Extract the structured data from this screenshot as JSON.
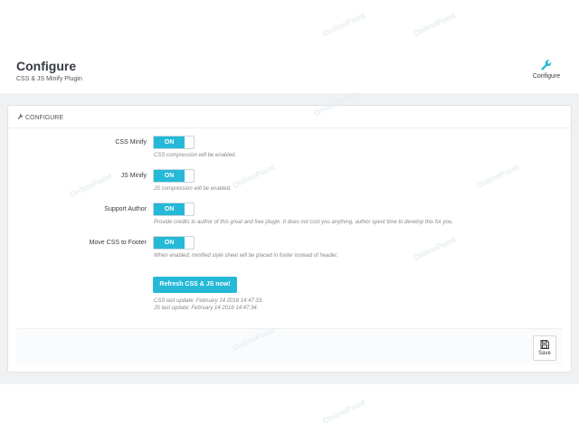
{
  "header": {
    "title": "Configure",
    "subtitle": "CSS & JS Minify Plugin",
    "toolbar_button_label": "Configure"
  },
  "panel": {
    "heading": "CONFIGURE",
    "fields": [
      {
        "label": "CSS Minify",
        "switch_label": "ON",
        "help": "CSS compression will be enabled."
      },
      {
        "label": "JS Minify",
        "switch_label": "ON",
        "help": "JS compression will be enabled."
      },
      {
        "label": "Support Author",
        "switch_label": "ON",
        "help": "Provide credits to author of this great and free plugin. It does not cost you anything, author spent time to develop this for you."
      },
      {
        "label": "Move CSS to Footer",
        "switch_label": "ON",
        "help": "When enabled, minified style sheet will be placed in footer instead of header."
      }
    ],
    "refresh_button_label": "Refresh CSS & JS now!",
    "css_last_update": "CSS last update: February 14 2018 14:47:33.",
    "js_last_update": "JS last update: February 14 2018 14:47:34.",
    "save_label": "Save"
  },
  "watermark_text": "OnlinePoint",
  "colors": {
    "accent": "#25b9d7",
    "background": "#eff1f2",
    "title": "#363a41"
  }
}
